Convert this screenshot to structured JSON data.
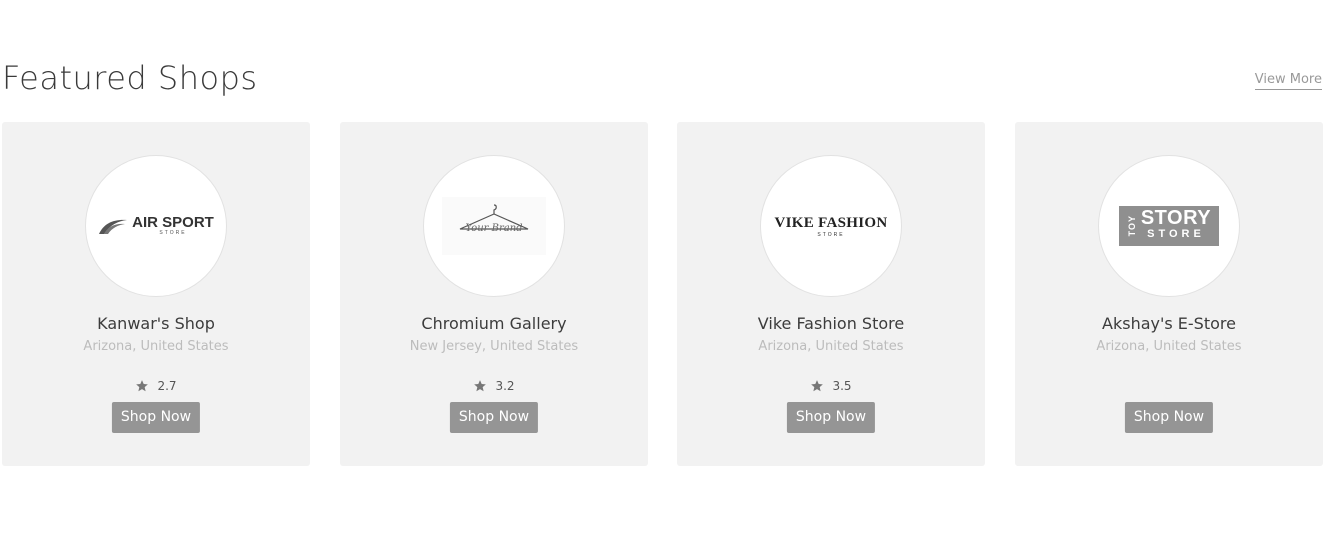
{
  "section": {
    "title": "Featured Shops",
    "view_more_label": "View More"
  },
  "shops": [
    {
      "name": "Kanwar's Shop",
      "location": "Arizona, United States",
      "rating": "2.7",
      "button_label": "Shop Now",
      "logo": {
        "word": "AIR SPORT",
        "sub": "STORE",
        "icon": "wing-icon"
      }
    },
    {
      "name": "Chromium Gallery",
      "location": "New Jersey, United States",
      "rating": "3.2",
      "button_label": "Shop Now",
      "logo": {
        "word": "Your Brand",
        "icon": "hanger-icon"
      }
    },
    {
      "name": "Vike Fashion Store",
      "location": "Arizona, United States",
      "rating": "3.5",
      "button_label": "Shop Now",
      "logo": {
        "word": "VIKE FASHION",
        "sub": "STORE"
      }
    },
    {
      "name": "Akshay's E-Store",
      "location": "Arizona, United States",
      "rating": "",
      "button_label": "Shop Now",
      "logo": {
        "side": "TOY",
        "word": "STORY",
        "sub": "STORE"
      }
    }
  ],
  "colors": {
    "card_background": "#f2f2f2",
    "button_background": "#959595",
    "muted_text": "#bcbcbc"
  }
}
